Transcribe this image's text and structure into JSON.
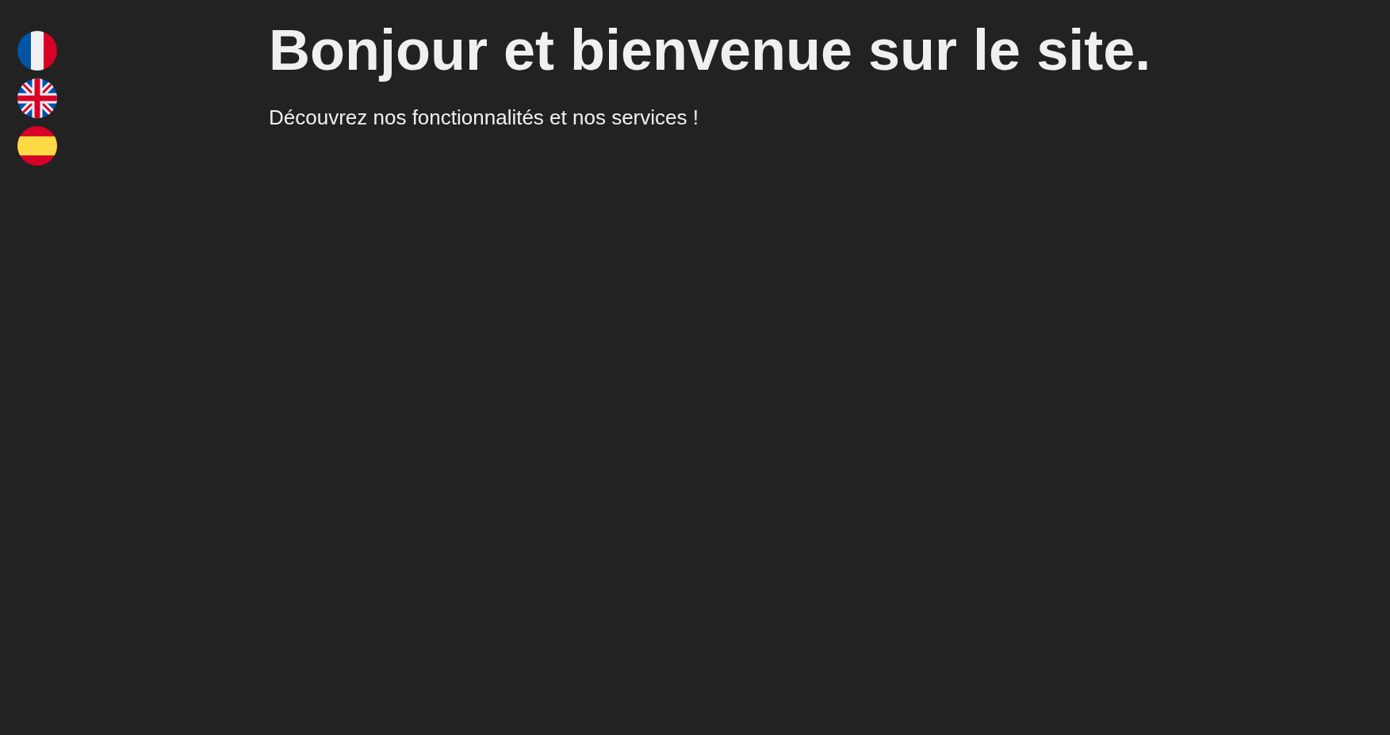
{
  "languages": [
    {
      "kind": "fr"
    },
    {
      "kind": "en"
    },
    {
      "kind": "es"
    }
  ],
  "heading": "Bonjour et bienvenue sur le site.",
  "subtitle": "Découvrez nos fonctionnalités et nos services !"
}
